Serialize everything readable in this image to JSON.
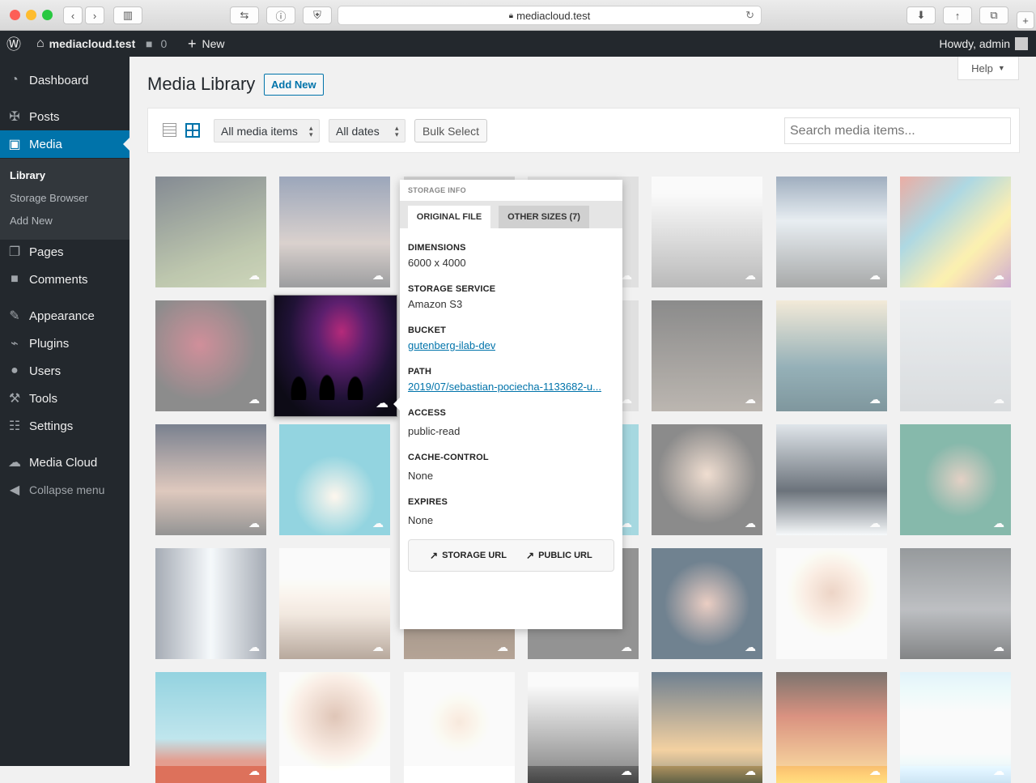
{
  "browser": {
    "url": "mediacloud.test",
    "colors": {
      "close": "#fd5f57",
      "minimize": "#febc2e",
      "zoom": "#28c840"
    }
  },
  "adminbar": {
    "site_name": "mediacloud.test",
    "comments_count": "0",
    "new_label": "New",
    "greeting": "Howdy, admin"
  },
  "sidebar": {
    "items": [
      {
        "label": "Dashboard",
        "icon": "dashboard-icon"
      },
      {
        "label": "Posts",
        "icon": "pin-icon"
      },
      {
        "label": "Media",
        "icon": "media-icon"
      },
      {
        "label": "Pages",
        "icon": "pages-icon"
      },
      {
        "label": "Comments",
        "icon": "comment-icon"
      },
      {
        "label": "Appearance",
        "icon": "brush-icon"
      },
      {
        "label": "Plugins",
        "icon": "plug-icon"
      },
      {
        "label": "Users",
        "icon": "user-icon"
      },
      {
        "label": "Tools",
        "icon": "wrench-icon"
      },
      {
        "label": "Settings",
        "icon": "settings-icon"
      },
      {
        "label": "Media Cloud",
        "icon": "cloud-icon"
      },
      {
        "label": "Collapse menu",
        "icon": "collapse-icon"
      }
    ],
    "submenu": [
      "Library",
      "Storage Browser",
      "Add New"
    ]
  },
  "page": {
    "title": "Media Library",
    "add_new": "Add New",
    "help": "Help"
  },
  "toolbar": {
    "filter_type": "All media items",
    "filter_date": "All dates",
    "bulk_select": "Bulk Select",
    "search_placeholder": "Search media items..."
  },
  "popup": {
    "header": "STORAGE INFO",
    "tab_original": "ORIGINAL FILE",
    "tab_other": "OTHER SIZES (7)",
    "dimensions_label": "DIMENSIONS",
    "dimensions": "6000 x 4000",
    "service_label": "STORAGE SERVICE",
    "service": "Amazon S3",
    "bucket_label": "BUCKET",
    "bucket": "gutenberg-ilab-dev",
    "path_label": "PATH",
    "path": "2019/07/sebastian-pociecha-1133682-u...",
    "access_label": "ACCESS",
    "access": "public-read",
    "cache_label": "CACHE-CONTROL",
    "cache": "None",
    "expires_label": "EXPIRES",
    "expires": "None",
    "storage_url": "STORAGE URL",
    "public_url": "PUBLIC URL"
  }
}
